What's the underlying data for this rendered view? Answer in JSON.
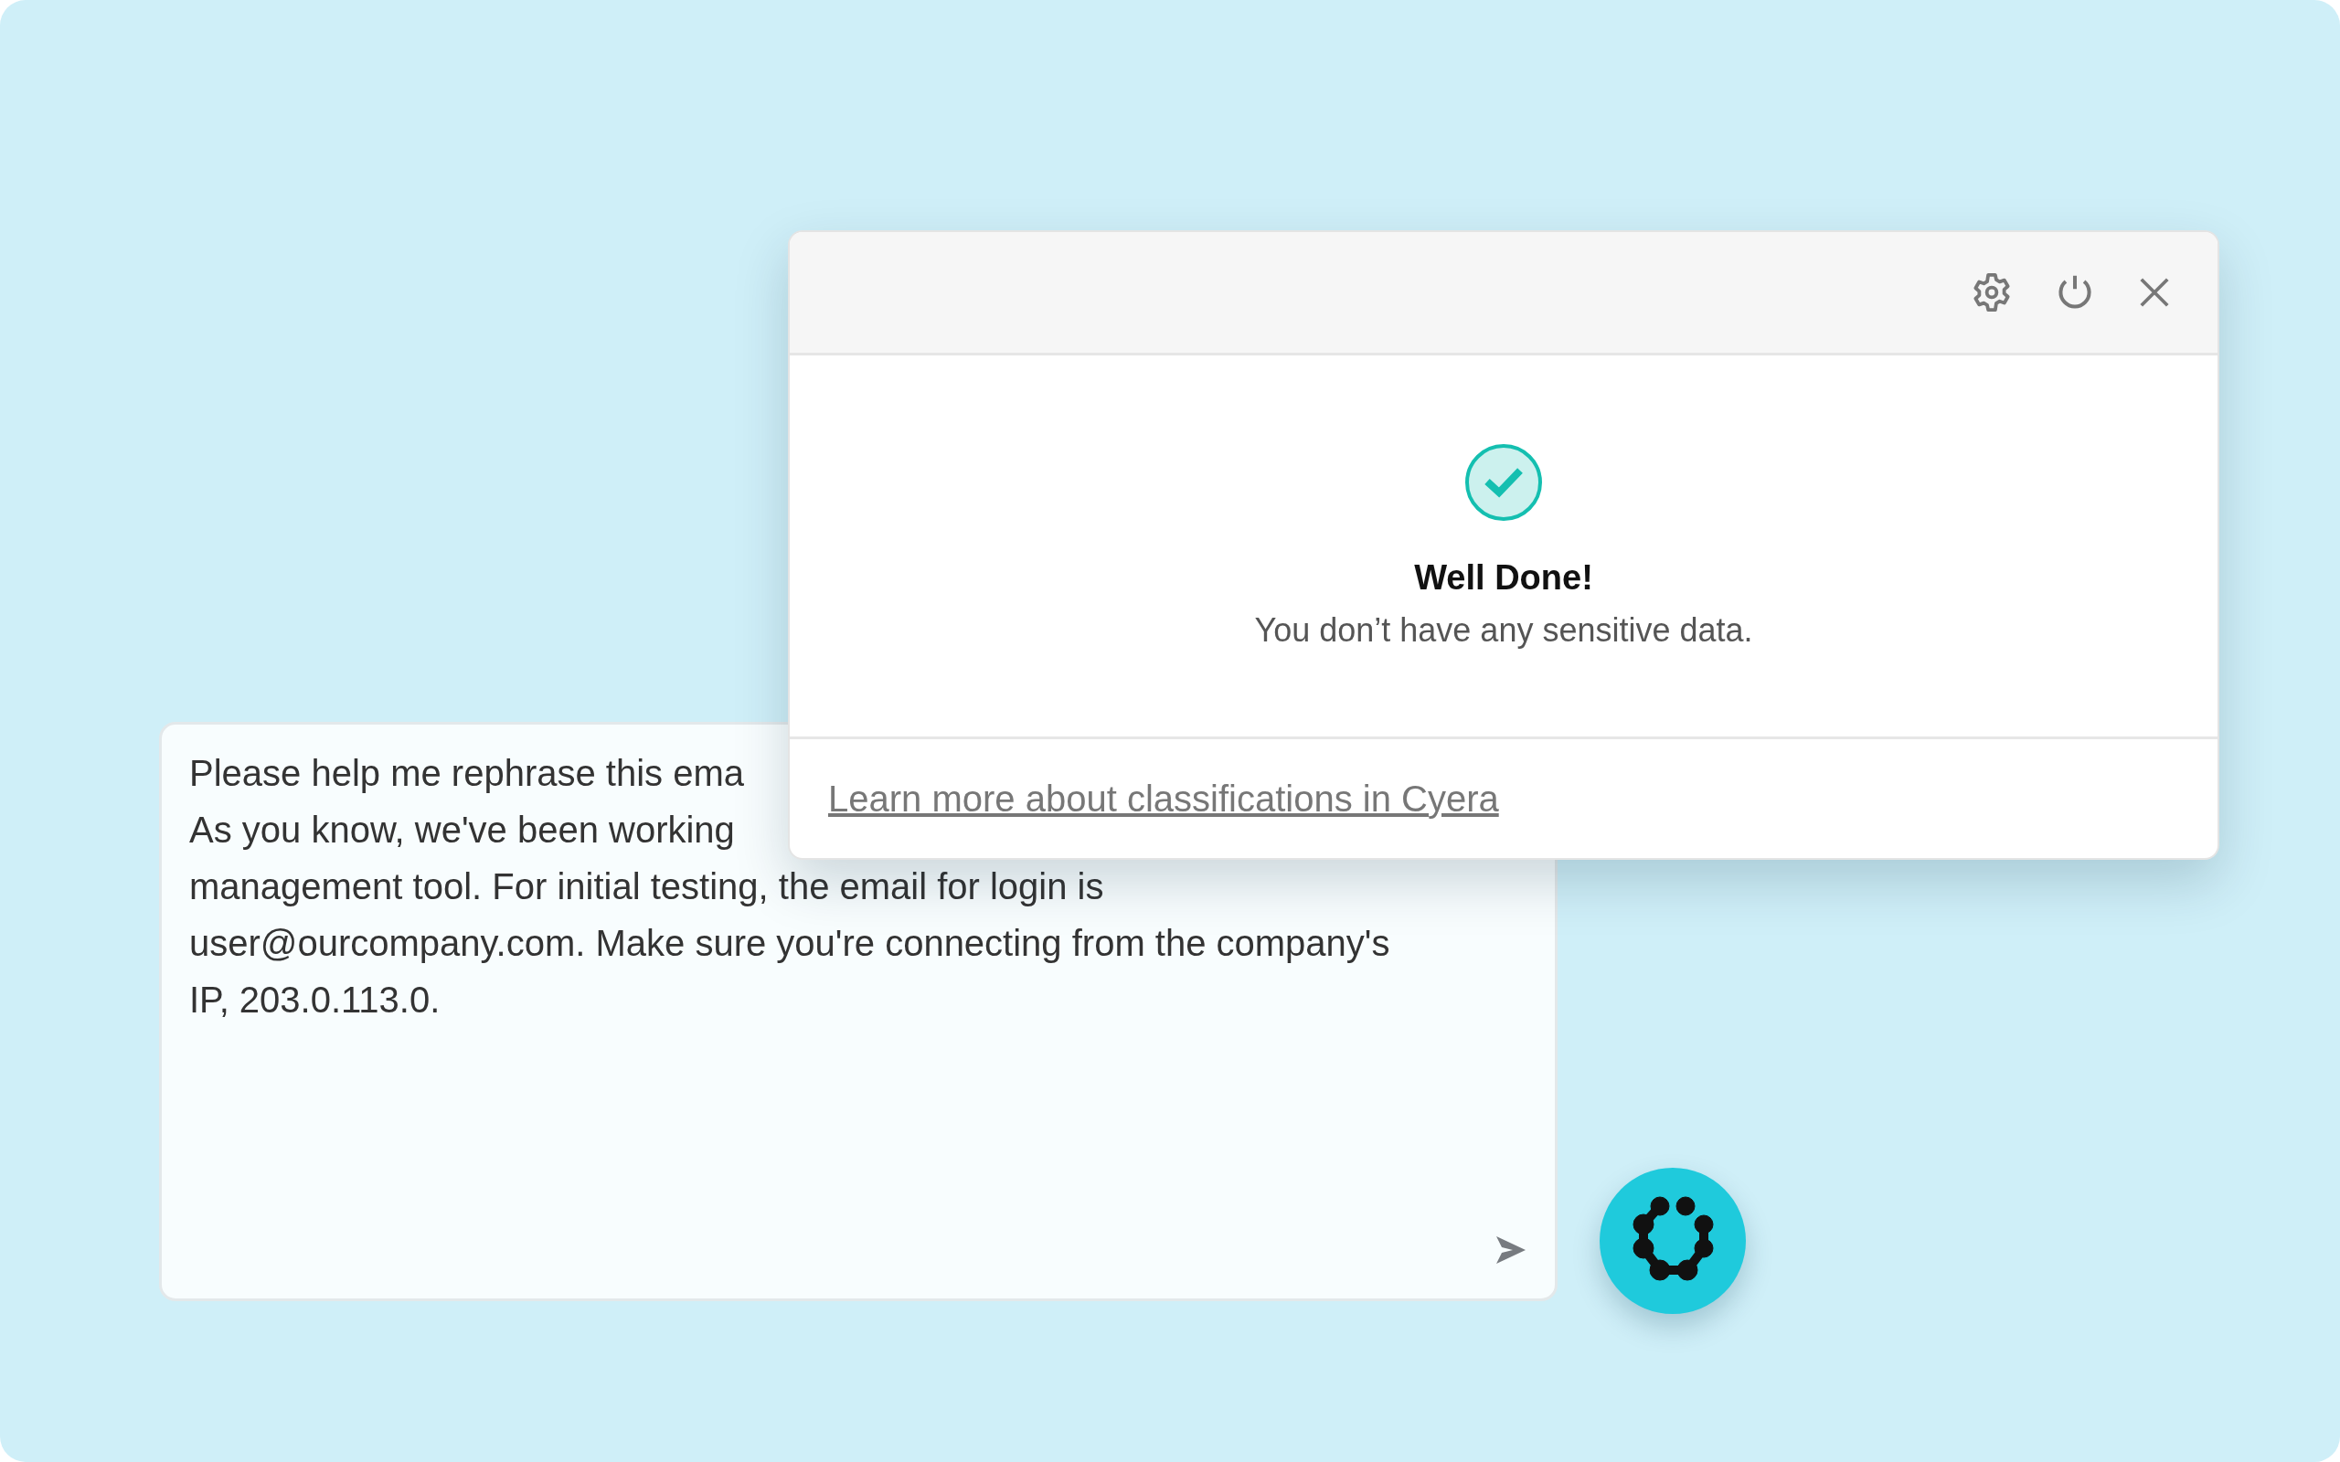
{
  "message": {
    "lines": [
      "Please help me rephrase this ema",
      "As you know, we've been working",
      "management tool. For initial testing, the email for login is",
      "user@ourcompany.com. Make sure you're connecting from the company's",
      "IP, 203.0.113.0."
    ]
  },
  "popup": {
    "title": "Well Done!",
    "subtitle": "You don’t have any sensitive data.",
    "link": "Learn more about classifications in Cyera"
  }
}
